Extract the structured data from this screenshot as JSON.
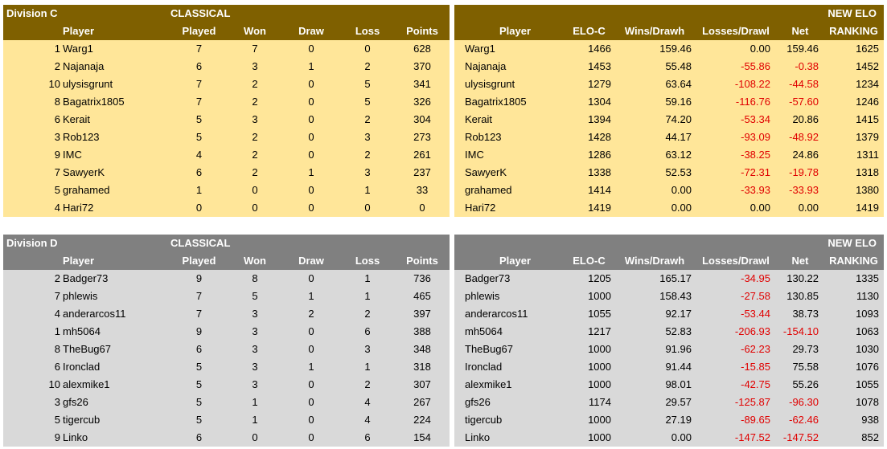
{
  "division_c": {
    "title": "Division C",
    "type": "CLASSICAL",
    "new_elo_line1": "NEW ELO",
    "left_headers": [
      "Player",
      "Played",
      "Won",
      "Draw",
      "Loss",
      "Points"
    ],
    "right_headers": [
      "Player",
      "ELO-C",
      "Wins/Drawh",
      "Losses/Drawl",
      "Net",
      "RANKING"
    ],
    "rows": [
      {
        "seed": "1",
        "player": "Warg1",
        "played": "7",
        "won": "7",
        "draw": "0",
        "loss": "0",
        "points": "628",
        "player2": "Warg1",
        "elo": "1466",
        "wins": "159.46",
        "losses": "0.00",
        "net": "159.46",
        "ranking": "1625",
        "losses_neg": false,
        "net_neg": false
      },
      {
        "seed": "2",
        "player": "Najanaja",
        "played": "6",
        "won": "3",
        "draw": "1",
        "loss": "2",
        "points": "370",
        "player2": "Najanaja",
        "elo": "1453",
        "wins": "55.48",
        "losses": "-55.86",
        "net": "-0.38",
        "ranking": "1452",
        "losses_neg": true,
        "net_neg": true
      },
      {
        "seed": "10",
        "player": "ulysisgrunt",
        "played": "7",
        "won": "2",
        "draw": "0",
        "loss": "5",
        "points": "341",
        "player2": "ulysisgrunt",
        "elo": "1279",
        "wins": "63.64",
        "losses": "-108.22",
        "net": "-44.58",
        "ranking": "1234",
        "losses_neg": true,
        "net_neg": true
      },
      {
        "seed": "8",
        "player": "Bagatrix1805",
        "played": "7",
        "won": "2",
        "draw": "0",
        "loss": "5",
        "points": "326",
        "player2": "Bagatrix1805",
        "elo": "1304",
        "wins": "59.16",
        "losses": "-116.76",
        "net": "-57.60",
        "ranking": "1246",
        "losses_neg": true,
        "net_neg": true
      },
      {
        "seed": "6",
        "player": "Kerait",
        "played": "5",
        "won": "3",
        "draw": "0",
        "loss": "2",
        "points": "304",
        "player2": "Kerait",
        "elo": "1394",
        "wins": "74.20",
        "losses": "-53.34",
        "net": "20.86",
        "ranking": "1415",
        "losses_neg": true,
        "net_neg": false
      },
      {
        "seed": "3",
        "player": "Rob123",
        "played": "5",
        "won": "2",
        "draw": "0",
        "loss": "3",
        "points": "273",
        "player2": "Rob123",
        "elo": "1428",
        "wins": "44.17",
        "losses": "-93.09",
        "net": "-48.92",
        "ranking": "1379",
        "losses_neg": true,
        "net_neg": true
      },
      {
        "seed": "9",
        "player": "IMC",
        "played": "4",
        "won": "2",
        "draw": "0",
        "loss": "2",
        "points": "261",
        "player2": "IMC",
        "elo": "1286",
        "wins": "63.12",
        "losses": "-38.25",
        "net": "24.86",
        "ranking": "1311",
        "losses_neg": true,
        "net_neg": false
      },
      {
        "seed": "7",
        "player": "SawyerK",
        "played": "6",
        "won": "2",
        "draw": "1",
        "loss": "3",
        "points": "237",
        "player2": "SawyerK",
        "elo": "1338",
        "wins": "52.53",
        "losses": "-72.31",
        "net": "-19.78",
        "ranking": "1318",
        "losses_neg": true,
        "net_neg": true
      },
      {
        "seed": "5",
        "player": "grahamed",
        "played": "1",
        "won": "0",
        "draw": "0",
        "loss": "1",
        "points": "33",
        "player2": "grahamed",
        "elo": "1414",
        "wins": "0.00",
        "losses": "-33.93",
        "net": "-33.93",
        "ranking": "1380",
        "losses_neg": true,
        "net_neg": true
      },
      {
        "seed": "4",
        "player": "Hari72",
        "played": "0",
        "won": "0",
        "draw": "0",
        "loss": "0",
        "points": "0",
        "player2": "Hari72",
        "elo": "1419",
        "wins": "0.00",
        "losses": "0.00",
        "net": "0.00",
        "ranking": "1419",
        "losses_neg": false,
        "net_neg": false
      }
    ]
  },
  "division_d": {
    "title": "Division D",
    "type": "CLASSICAL",
    "new_elo_line1": "NEW ELO",
    "left_headers": [
      "Player",
      "Played",
      "Won",
      "Draw",
      "Loss",
      "Points"
    ],
    "right_headers": [
      "Player",
      "ELO-C",
      "Wins/Drawh",
      "Losses/Drawl",
      "Net",
      "RANKING"
    ],
    "rows": [
      {
        "seed": "2",
        "player": "Badger73",
        "played": "9",
        "won": "8",
        "draw": "0",
        "loss": "1",
        "points": "736",
        "player2": "Badger73",
        "elo": "1205",
        "wins": "165.17",
        "losses": "-34.95",
        "net": "130.22",
        "ranking": "1335",
        "losses_neg": true,
        "net_neg": false
      },
      {
        "seed": "7",
        "player": "phlewis",
        "played": "7",
        "won": "5",
        "draw": "1",
        "loss": "1",
        "points": "465",
        "player2": "phlewis",
        "elo": "1000",
        "wins": "158.43",
        "losses": "-27.58",
        "net": "130.85",
        "ranking": "1130",
        "losses_neg": true,
        "net_neg": false
      },
      {
        "seed": "4",
        "player": "anderarcos11",
        "played": "7",
        "won": "3",
        "draw": "2",
        "loss": "2",
        "points": "397",
        "player2": "anderarcos11",
        "elo": "1055",
        "wins": "92.17",
        "losses": "-53.44",
        "net": "38.73",
        "ranking": "1093",
        "losses_neg": true,
        "net_neg": false
      },
      {
        "seed": "1",
        "player": "mh5064",
        "played": "9",
        "won": "3",
        "draw": "0",
        "loss": "6",
        "points": "388",
        "player2": "mh5064",
        "elo": "1217",
        "wins": "52.83",
        "losses": "-206.93",
        "net": "-154.10",
        "ranking": "1063",
        "losses_neg": true,
        "net_neg": true
      },
      {
        "seed": "8",
        "player": "TheBug67",
        "played": "6",
        "won": "3",
        "draw": "0",
        "loss": "3",
        "points": "348",
        "player2": "TheBug67",
        "elo": "1000",
        "wins": "91.96",
        "losses": "-62.23",
        "net": "29.73",
        "ranking": "1030",
        "losses_neg": true,
        "net_neg": false
      },
      {
        "seed": "6",
        "player": "Ironclad",
        "played": "5",
        "won": "3",
        "draw": "1",
        "loss": "1",
        "points": "318",
        "player2": "Ironclad",
        "elo": "1000",
        "wins": "91.44",
        "losses": "-15.85",
        "net": "75.58",
        "ranking": "1076",
        "losses_neg": true,
        "net_neg": false
      },
      {
        "seed": "10",
        "player": "alexmike1",
        "played": "5",
        "won": "3",
        "draw": "0",
        "loss": "2",
        "points": "307",
        "player2": "alexmike1",
        "elo": "1000",
        "wins": "98.01",
        "losses": "-42.75",
        "net": "55.26",
        "ranking": "1055",
        "losses_neg": true,
        "net_neg": false
      },
      {
        "seed": "3",
        "player": "gfs26",
        "played": "5",
        "won": "1",
        "draw": "0",
        "loss": "4",
        "points": "267",
        "player2": "gfs26",
        "elo": "1174",
        "wins": "29.57",
        "losses": "-125.87",
        "net": "-96.30",
        "ranking": "1078",
        "losses_neg": true,
        "net_neg": true
      },
      {
        "seed": "5",
        "player": "tigercub",
        "played": "5",
        "won": "1",
        "draw": "0",
        "loss": "4",
        "points": "224",
        "player2": "tigercub",
        "elo": "1000",
        "wins": "27.19",
        "losses": "-89.65",
        "net": "-62.46",
        "ranking": "938",
        "losses_neg": true,
        "net_neg": true
      },
      {
        "seed": "9",
        "player": "Linko",
        "played": "6",
        "won": "0",
        "draw": "0",
        "loss": "6",
        "points": "154",
        "player2": "Linko",
        "elo": "1000",
        "wins": "0.00",
        "losses": "-147.52",
        "net": "-147.52",
        "ranking": "852",
        "losses_neg": true,
        "net_neg": true
      }
    ]
  },
  "colors": {
    "c_header": "#7f6000",
    "c_fill": "#ffe699",
    "d_header": "#808080",
    "d_fill": "#d9d9d9",
    "negative": "#e00000"
  }
}
